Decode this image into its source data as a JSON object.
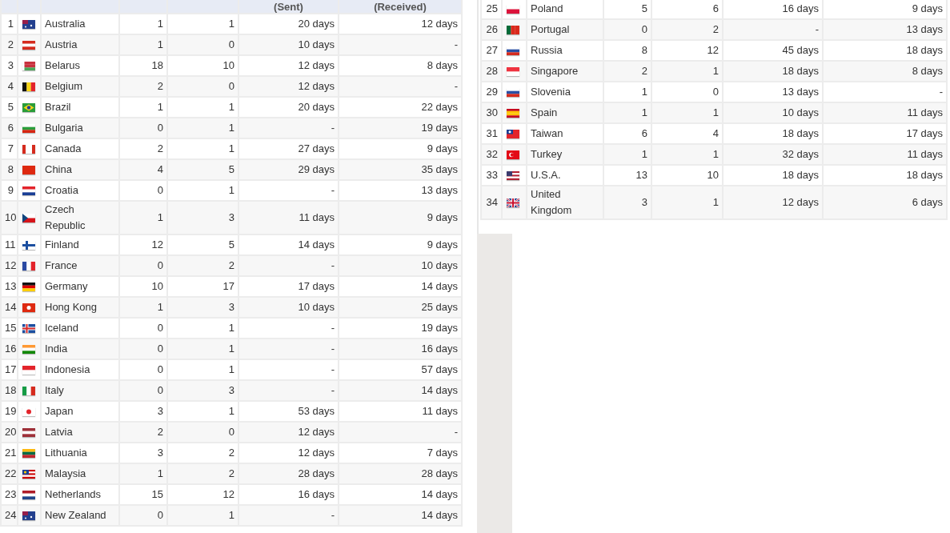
{
  "tables": [
    {
      "header": {
        "sent": "(Sent)",
        "received": "(Received)"
      },
      "rows": [
        {
          "number": "1",
          "country": "Australia",
          "column_4": "1",
          "column_5": "1",
          "sent": "20 days",
          "received": "12 days"
        },
        {
          "number": "2",
          "country": "Austria",
          "column_4": "1",
          "column_5": "0",
          "sent": "10 days",
          "received": "-"
        },
        {
          "number": "3",
          "country": "Belarus",
          "column_4": "18",
          "column_5": "10",
          "sent": "12 days",
          "received": "8 days"
        },
        {
          "number": "4",
          "country": "Belgium",
          "column_4": "2",
          "column_5": "0",
          "sent": "12 days",
          "received": "-"
        },
        {
          "number": "5",
          "country": "Brazil",
          "column_4": "1",
          "column_5": "1",
          "sent": "20 days",
          "received": "22 days"
        },
        {
          "number": "6",
          "country": "Bulgaria",
          "column_4": "0",
          "column_5": "1",
          "sent": "-",
          "received": "19 days"
        },
        {
          "number": "7",
          "country": "Canada",
          "column_4": "2",
          "column_5": "1",
          "sent": "27 days",
          "received": "9 days"
        },
        {
          "number": "8",
          "country": "China",
          "column_4": "4",
          "column_5": "5",
          "sent": "29 days",
          "received": "35 days"
        },
        {
          "number": "9",
          "country": "Croatia",
          "column_4": "0",
          "column_5": "1",
          "sent": "-",
          "received": "13 days"
        },
        {
          "number": "10",
          "country": "Czech Republic",
          "column_4": "1",
          "column_5": "3",
          "sent": "11 days",
          "received": "9 days"
        },
        {
          "number": "11",
          "country": "Finland",
          "column_4": "12",
          "column_5": "5",
          "sent": "14 days",
          "received": "9 days"
        },
        {
          "number": "12",
          "country": "France",
          "column_4": "0",
          "column_5": "2",
          "sent": "-",
          "received": "10 days"
        },
        {
          "number": "13",
          "country": "Germany",
          "column_4": "10",
          "column_5": "17",
          "sent": "17 days",
          "received": "14 days"
        },
        {
          "number": "14",
          "country": "Hong Kong",
          "column_4": "1",
          "column_5": "3",
          "sent": "10 days",
          "received": "25 days"
        },
        {
          "number": "15",
          "country": "Iceland",
          "column_4": "0",
          "column_5": "1",
          "sent": "-",
          "received": "19 days"
        },
        {
          "number": "16",
          "country": "India",
          "column_4": "0",
          "column_5": "1",
          "sent": "-",
          "received": "16 days"
        },
        {
          "number": "17",
          "country": "Indonesia",
          "column_4": "0",
          "column_5": "1",
          "sent": "-",
          "received": "57 days"
        },
        {
          "number": "18",
          "country": "Italy",
          "column_4": "0",
          "column_5": "3",
          "sent": "-",
          "received": "14 days"
        },
        {
          "number": "19",
          "country": "Japan",
          "column_4": "3",
          "column_5": "1",
          "sent": "53 days",
          "received": "11 days"
        },
        {
          "number": "20",
          "country": "Latvia",
          "column_4": "2",
          "column_5": "0",
          "sent": "12 days",
          "received": "-"
        },
        {
          "number": "21",
          "country": "Lithuania",
          "column_4": "3",
          "column_5": "2",
          "sent": "12 days",
          "received": "7 days"
        },
        {
          "number": "22",
          "country": "Malaysia",
          "column_4": "1",
          "column_5": "2",
          "sent": "28 days",
          "received": "28 days"
        },
        {
          "number": "23",
          "country": "Netherlands",
          "column_4": "15",
          "column_5": "12",
          "sent": "16 days",
          "received": "14 days"
        },
        {
          "number": "24",
          "country": "New Zealand",
          "column_4": "0",
          "column_5": "1",
          "sent": "-",
          "received": "14 days"
        }
      ]
    },
    {
      "rows": [
        {
          "number": "25",
          "country": "Poland",
          "column_4": "5",
          "column_5": "6",
          "sent": "16 days",
          "received": "9 days"
        },
        {
          "number": "26",
          "country": "Portugal",
          "column_4": "0",
          "column_5": "2",
          "sent": "-",
          "received": "13 days"
        },
        {
          "number": "27",
          "country": "Russia",
          "column_4": "8",
          "column_5": "12",
          "sent": "45 days",
          "received": "18 days"
        },
        {
          "number": "28",
          "country": "Singapore",
          "column_4": "2",
          "column_5": "1",
          "sent": "18 days",
          "received": "8 days"
        },
        {
          "number": "29",
          "country": "Slovenia",
          "column_4": "1",
          "column_5": "0",
          "sent": "13 days",
          "received": "-"
        },
        {
          "number": "30",
          "country": "Spain",
          "column_4": "1",
          "column_5": "1",
          "sent": "10 days",
          "received": "11 days"
        },
        {
          "number": "31",
          "country": "Taiwan",
          "column_4": "6",
          "column_5": "4",
          "sent": "18 days",
          "received": "17 days"
        },
        {
          "number": "32",
          "country": "Turkey",
          "column_4": "1",
          "column_5": "1",
          "sent": "32 days",
          "received": "11 days"
        },
        {
          "number": "33",
          "country": "U.S.A.",
          "column_4": "13",
          "column_5": "10",
          "sent": "18 days",
          "received": "18 days"
        },
        {
          "number": "34",
          "country": "United Kingdom",
          "column_4": "3",
          "column_5": "1",
          "sent": "12 days",
          "received": "6 days"
        }
      ]
    }
  ]
}
